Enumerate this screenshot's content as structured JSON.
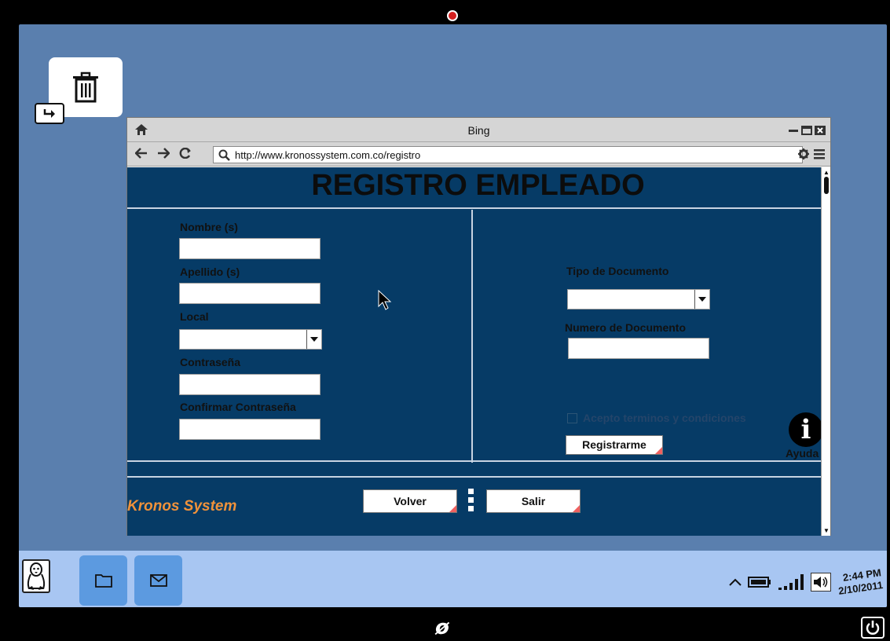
{
  "browser": {
    "title": "Bing",
    "url": "http://www.kronossystem.com.co/registro"
  },
  "page": {
    "heading": "REGISTRO EMPLEADO",
    "left_form": {
      "nombre_label": "Nombre (s)",
      "nombre_value": "",
      "apellido_label": "Apellido (s)",
      "apellido_value": "",
      "local_label": "Local",
      "local_value": "",
      "password_label": "Contraseña",
      "password_value": "",
      "confirm_password_label": "Confirmar Contraseña",
      "confirm_password_value": ""
    },
    "right_form": {
      "tipo_documento_label": "Tipo de Documento",
      "tipo_documento_value": "",
      "numero_documento_label": "Numero de Documento",
      "numero_documento_value": "",
      "terms_label": "Acepto terminos y condiciones",
      "terms_checked": false,
      "register_button": "Registrarme",
      "help_label": "Ayuda"
    },
    "footer": {
      "brand": "Kronos System",
      "back_button": "Volver",
      "exit_button": "Salir"
    }
  },
  "taskbar": {
    "time": "2:44 PM",
    "date": "2/10/2011"
  },
  "colors": {
    "page_background": "#063b66",
    "desktop": "#5a7fae",
    "taskbar": "#a8c6f2",
    "brand": "#f0923a",
    "taskbar_button": "#5c9ae0"
  }
}
